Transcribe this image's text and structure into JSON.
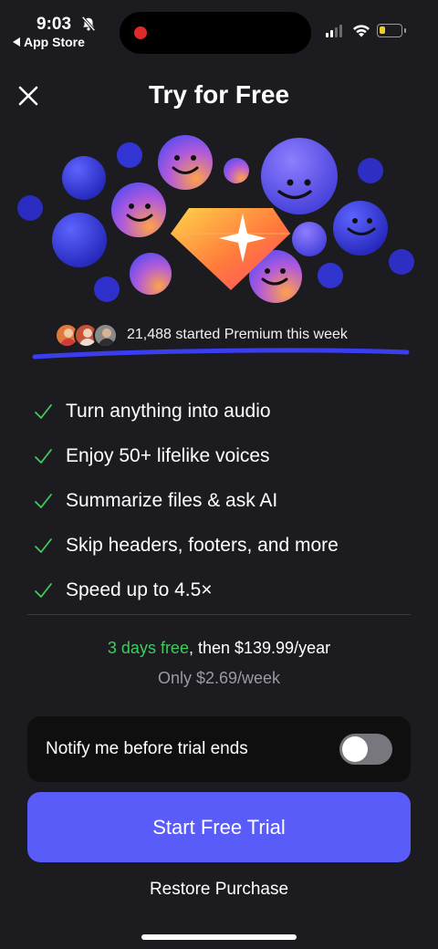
{
  "status_bar": {
    "time": "9:03",
    "back_app": "App Store",
    "icons": [
      "bell-slash-icon",
      "cellular-signal-icon",
      "wifi-icon",
      "battery-icon"
    ],
    "battery_level": 0.3
  },
  "header": {
    "title": "Try for Free",
    "close_icon": "close-icon"
  },
  "social_proof": {
    "text": "21,488 started Premium this week",
    "avatar_count": 3
  },
  "features": [
    {
      "label": "Turn anything into audio"
    },
    {
      "label": "Enjoy 50+ lifelike voices"
    },
    {
      "label": "Summarize files & ask AI"
    },
    {
      "label": "Skip headers, footers, and more"
    },
    {
      "label": "Speed up to 4.5×"
    }
  ],
  "pricing": {
    "trial": "3 days free",
    "then": ", then $139.99/year",
    "weekly": "Only $2.69/week"
  },
  "notify": {
    "label": "Notify me before trial ends",
    "enabled": false
  },
  "cta": {
    "label": "Start Free Trial"
  },
  "restore": {
    "label": "Restore Purchase"
  },
  "colors": {
    "background": "#1c1b1f",
    "accent": "#5a5cf9",
    "green": "#3fcc5e",
    "muted": "#9a9aa0",
    "toggle_off": "#77777d"
  }
}
